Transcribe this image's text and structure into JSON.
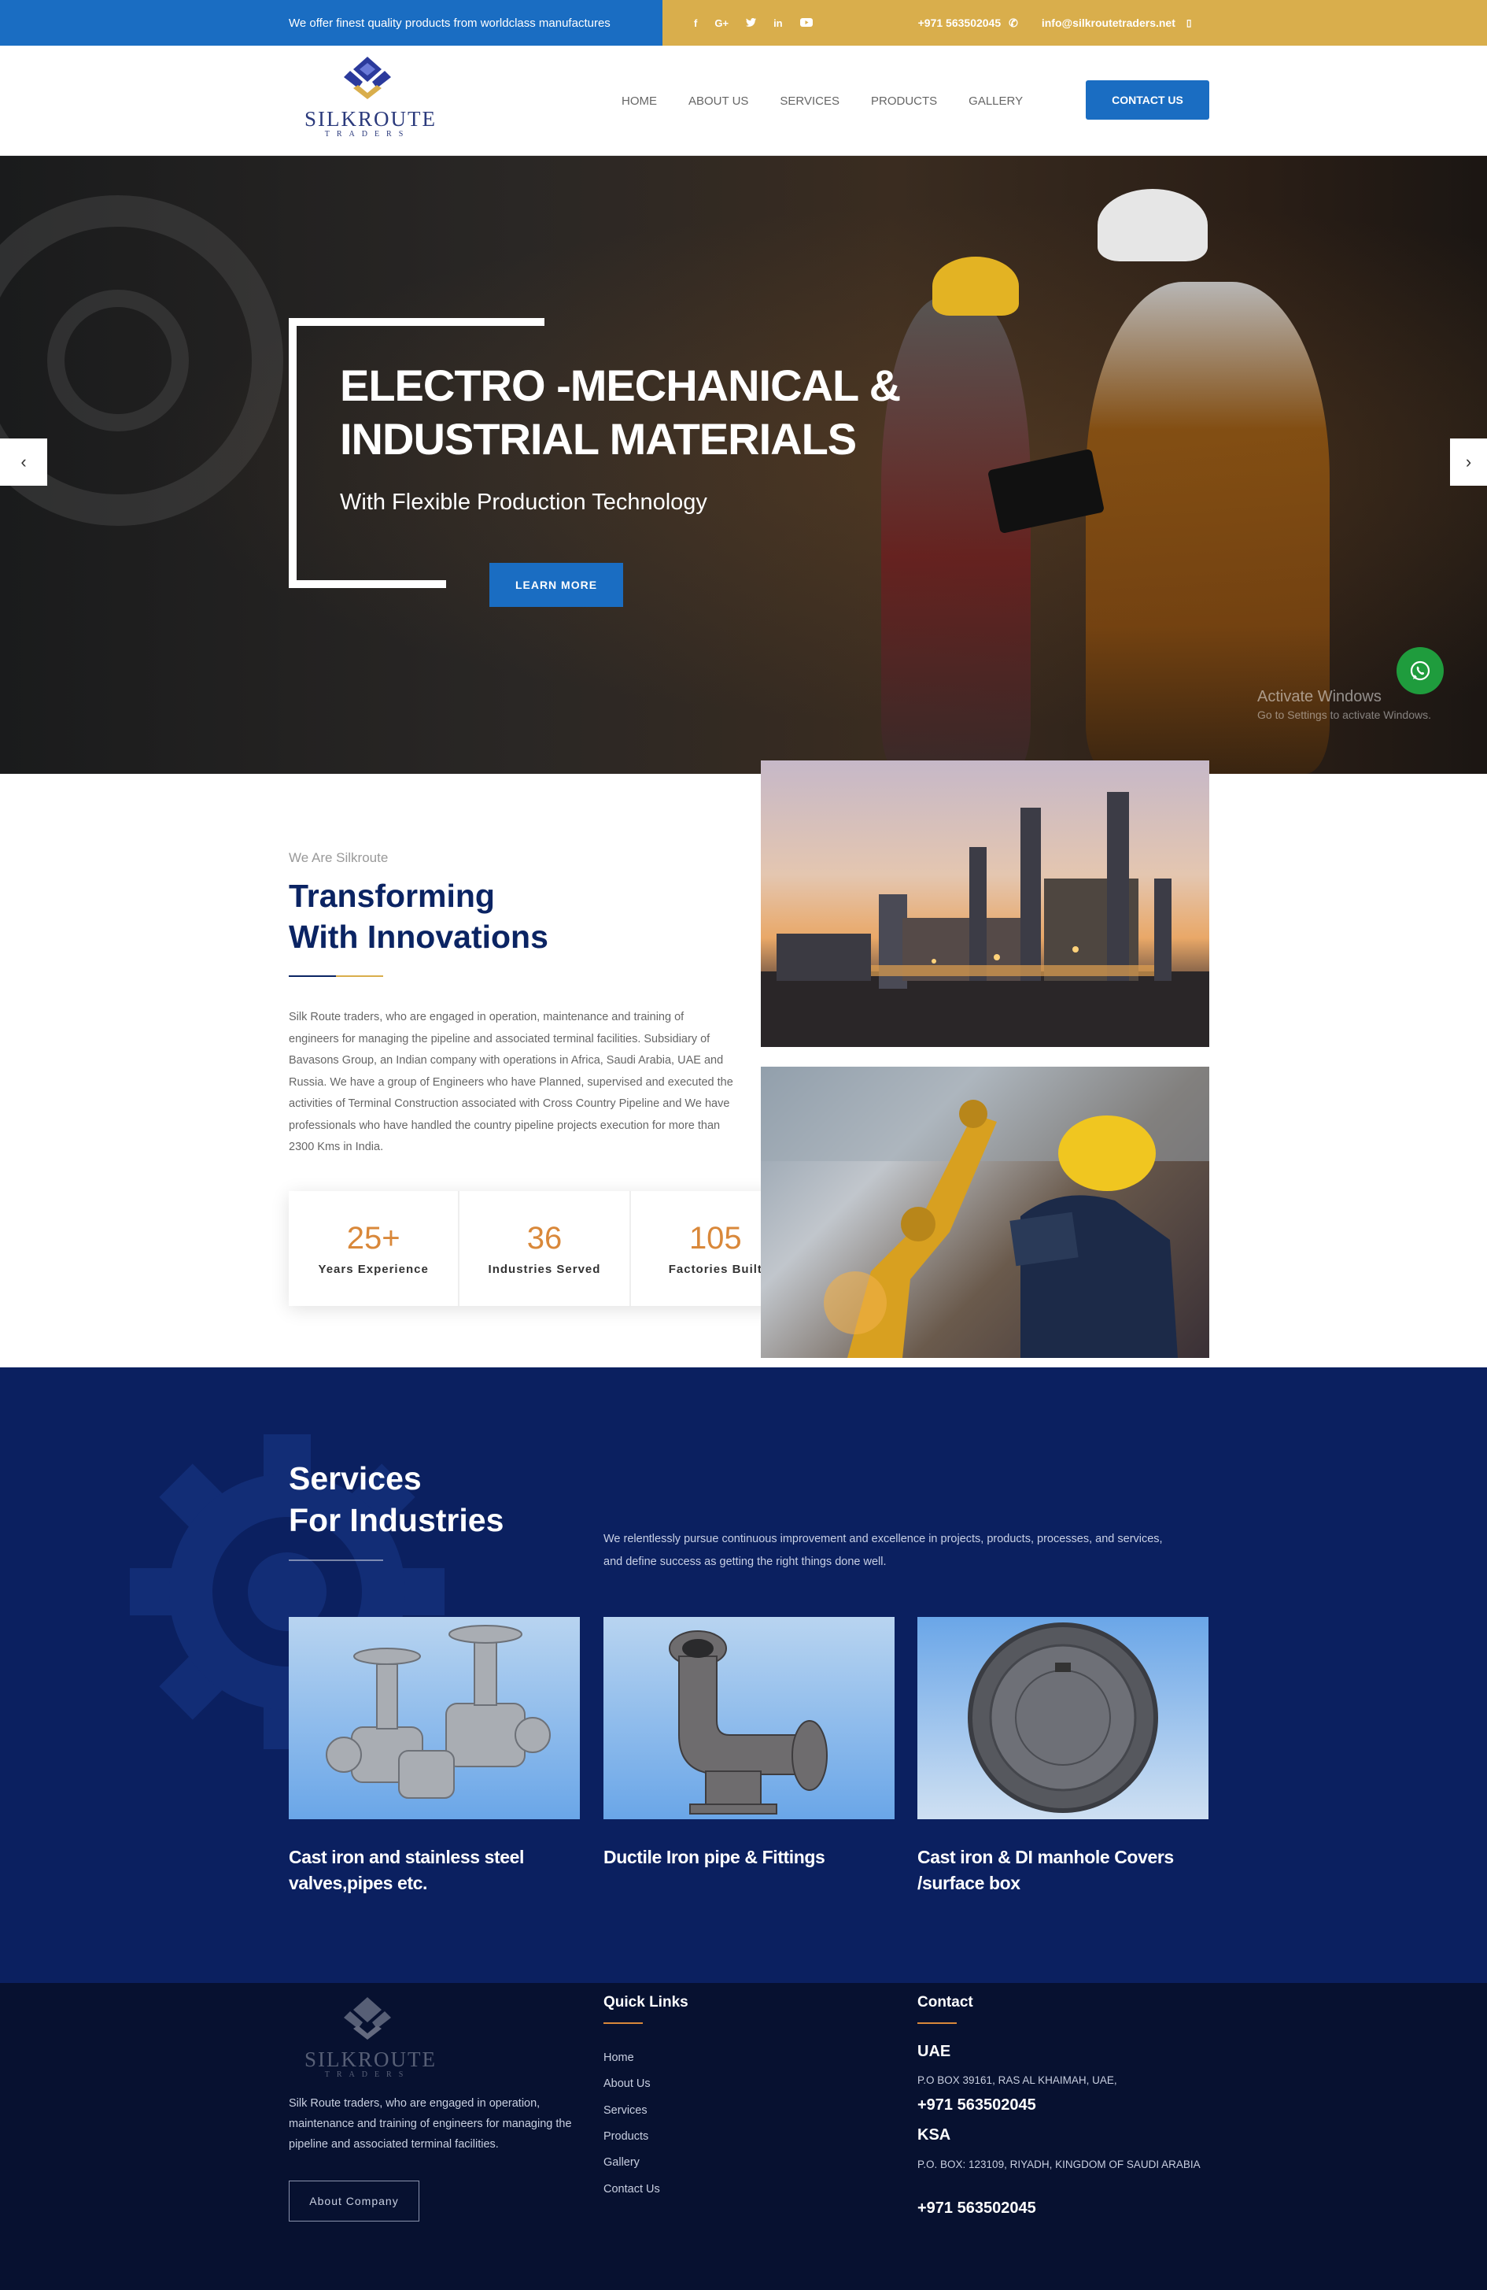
{
  "topbar": {
    "tagline": "We offer finest quality products from worldclass manufactures",
    "social": [
      "f",
      "G+",
      "t",
      "in",
      "yt"
    ],
    "phone": "+971 563502045",
    "email": "info@silkroutetraders.net"
  },
  "header": {
    "logo_name": "SILKROUTE",
    "logo_sub": "TRADERS",
    "nav": [
      "HOME",
      "ABOUT US",
      "SERVICES",
      "PRODUCTS",
      "GALLERY"
    ],
    "contact_label": "CONTACT US"
  },
  "hero": {
    "title_line1": "ELECTRO -MECHANICAL &",
    "title_line2": "INDUSTRIAL MATERIALS",
    "subtitle": "With Flexible Production Technology",
    "button": "LEARN MORE",
    "prev": "‹",
    "next": "›",
    "windows_title": "Activate Windows",
    "windows_sub": "Go to Settings to activate Windows."
  },
  "about": {
    "eyebrow": "We Are Silkroute",
    "title_line1": "Transforming",
    "title_line2": "With Innovations",
    "text": "Silk Route traders, who are engaged in operation, maintenance and training of engineers for managing the pipeline and associated terminal facilities. Subsidiary of Bavasons Group, an Indian company with operations in Africa, Saudi Arabia, UAE and Russia. We have a group of Engineers who have Planned, supervised and executed the activities of Terminal Construction associated with Cross Country Pipeline and We have professionals who have handled the country pipeline projects execution for more than 2300 Kms in India.",
    "stats": [
      {
        "value": "25+",
        "label": "Years Experience"
      },
      {
        "value": "36",
        "label": "Industries Served"
      },
      {
        "value": "105",
        "label": "Factories Built"
      }
    ]
  },
  "services": {
    "title_line1": "Services",
    "title_line2": "For Industries",
    "description": "We relentlessly pursue continuous improvement and excellence in projects, products, processes, and services, and define success as getting the right things done well.",
    "cards": [
      {
        "title": "Cast iron and stainless steel valves,pipes etc."
      },
      {
        "title": "Ductile Iron pipe & Fittings"
      },
      {
        "title": "Cast iron & DI manhole Covers /surface box"
      }
    ]
  },
  "footer": {
    "about": "Silk Route traders, who are engaged in operation, maintenance and training of engineers for managing the pipeline and associated terminal facilities.",
    "about_button": "About Company",
    "quick_links_title": "Quick Links",
    "quick_links": [
      "Home",
      "About Us",
      "Services",
      "Products",
      "Gallery",
      "Contact Us"
    ],
    "contact_title": "Contact",
    "uae_label": "UAE",
    "uae_address": "P.O BOX 39161, RAS AL KHAIMAH, UAE,",
    "uae_phone": "+971 563502045",
    "ksa_label": "KSA",
    "ksa_address": "P.O. BOX: 123109, RIYADH, KINGDOM OF SAUDI ARABIA",
    "ksa_phone": "+971 563502045"
  },
  "colors": {
    "primary_blue": "#1a6dc2",
    "gold": "#d9ae4c",
    "navy": "#0b2060",
    "footer_navy": "#071130",
    "stat_orange": "#d9883a"
  }
}
